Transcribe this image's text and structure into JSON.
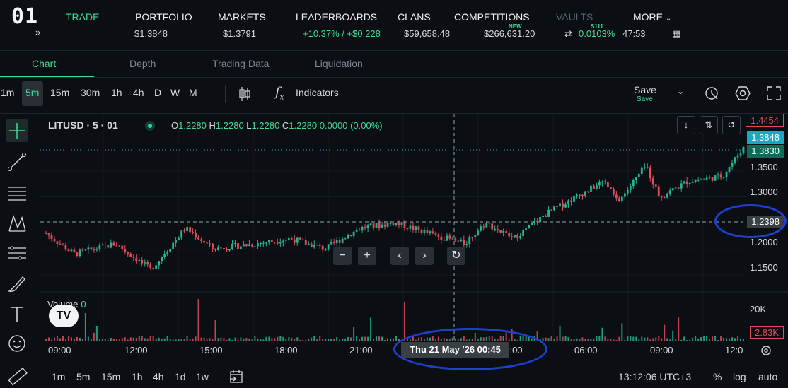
{
  "app": {
    "logo": "01"
  },
  "nav": {
    "items": [
      {
        "label": "TRADE",
        "active": true
      },
      {
        "label": "PORTFOLIO"
      },
      {
        "label": "MARKETS"
      },
      {
        "label": "LEADERBOARDS"
      },
      {
        "label": "CLANS"
      },
      {
        "label": "COMPETITIONS",
        "badge": "NEW"
      },
      {
        "label": "VAULTS",
        "badge": "S111",
        "dim": true
      },
      {
        "label": "MORE"
      }
    ]
  },
  "ticker": {
    "mark_price": "$1.3848",
    "oracle_price": "$1.3791",
    "change": "+10.37% / +$0.228",
    "volume_24h": "$59,658.48",
    "open_interest": "$266,631.20",
    "funding": "0.0103%",
    "countdown": "47:53"
  },
  "chart_tabs": [
    "Chart",
    "Depth",
    "Trading Data",
    "Liquidation"
  ],
  "toolbar": {
    "timeframes": [
      "1m",
      "5m",
      "15m",
      "30m",
      "1h",
      "4h",
      "D",
      "W",
      "M"
    ],
    "active_timeframe": "5m",
    "indicators_label": "Indicators",
    "save_label": "Save",
    "save_sub": "Save"
  },
  "left_tools": [
    "crosshair-icon",
    "trendline-icon",
    "fib-levels-icon",
    "pattern-icon",
    "projection-icon",
    "brush-icon",
    "text-icon",
    "emoji-icon",
    "ruler-icon"
  ],
  "legend": {
    "symbol": "LITUSD · 5 · 01",
    "o_label": "O",
    "o": "1.2280",
    "h_label": "H",
    "h": "1.2280",
    "l_label": "L",
    "l": "1.2280",
    "c_label": "C",
    "c": "1.2280",
    "change": "0.0000 (0.00%)"
  },
  "volume": {
    "label": "Volume",
    "value": "0",
    "logo_text": "TV"
  },
  "price_axis": {
    "ticks": [
      "1.3500",
      "1.3000",
      "1.2000",
      "1.1500"
    ],
    "high_label": "1.4454",
    "last_label": "1.3848",
    "ref_label": "1.3830",
    "crosshair_label": "1.2398",
    "vol_ticks": [
      "20K"
    ],
    "vol_last": "2.83K"
  },
  "time_axis": {
    "ticks": [
      "09:00",
      "12:00",
      "15:00",
      "18:00",
      "21:00",
      "00:00",
      "06:00",
      "09:00",
      "12:0"
    ],
    "crosshair_time": "Thu 21 May '26   00:45"
  },
  "chart_controls": [
    "zoom-out",
    "zoom-in",
    "scroll-left",
    "scroll-right",
    "reset"
  ],
  "bottom": {
    "ranges": [
      "1m",
      "5m",
      "15m",
      "1h",
      "4h",
      "1d",
      "1w"
    ],
    "clock": "13:12:06 UTC+3",
    "percent": "%",
    "log": "log",
    "auto": "auto"
  },
  "colors": {
    "up": "#22b58f",
    "down": "#e34b5a",
    "accent": "#3ddc97",
    "annotation": "#1f3fcf"
  },
  "chart_data": {
    "type": "candlestick",
    "symbol": "LITUSD",
    "interval": "5",
    "ylim": [
      1.12,
      1.46
    ],
    "anchors": [
      [
        0,
        1.23
      ],
      [
        0.04,
        1.19
      ],
      [
        0.1,
        1.21
      ],
      [
        0.15,
        1.16
      ],
      [
        0.2,
        1.24
      ],
      [
        0.24,
        1.2
      ],
      [
        0.3,
        1.21
      ],
      [
        0.35,
        1.22
      ],
      [
        0.4,
        1.2
      ],
      [
        0.45,
        1.24
      ],
      [
        0.5,
        1.25
      ],
      [
        0.55,
        1.23
      ],
      [
        0.6,
        1.21
      ],
      [
        0.63,
        1.25
      ],
      [
        0.67,
        1.22
      ],
      [
        0.72,
        1.27
      ],
      [
        0.76,
        1.3
      ],
      [
        0.8,
        1.33
      ],
      [
        0.82,
        1.29
      ],
      [
        0.86,
        1.36
      ],
      [
        0.88,
        1.3
      ],
      [
        0.92,
        1.33
      ],
      [
        0.97,
        1.34
      ],
      [
        1.0,
        1.395
      ]
    ],
    "last": 1.3848,
    "high": 1.4454,
    "crosshair_price": 1.2398,
    "volume_max_label": "20K",
    "volume_last": "2.83K"
  }
}
